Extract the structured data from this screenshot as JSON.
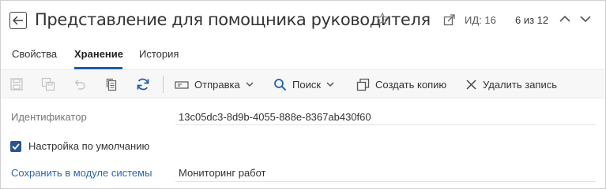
{
  "header": {
    "title": "Представление для помощника руководителя",
    "id_text": "ИД: 16",
    "pager_text": "6 из 12"
  },
  "tabs": [
    {
      "label": "Свойства",
      "active": false
    },
    {
      "label": "Хранение",
      "active": true
    },
    {
      "label": "История",
      "active": false
    }
  ],
  "toolbar": {
    "send_label": "Отправка",
    "search_label": "Поиск",
    "copy_label": "Создать копию",
    "delete_label": "Удалить запись"
  },
  "form": {
    "identifier_label": "Идентификатор",
    "identifier_value": "13c05dc3-8d9b-4055-888e-8367ab430f60",
    "default_setting_label": "Настройка по умолчанию",
    "default_setting_checked": true,
    "save_module_label": "Сохранить в модуле системы",
    "save_module_value": "Мониторинг работ"
  },
  "colors": {
    "accent": "#1f5ca8",
    "checkbox": "#2a5591",
    "link": "#2b66ad",
    "toolbar_bg": "#f7f7f7"
  }
}
